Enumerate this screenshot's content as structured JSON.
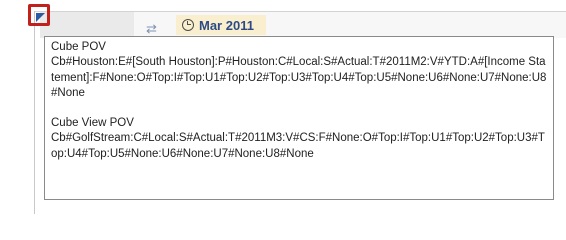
{
  "header": {
    "period_label": "Mar 2011",
    "sync_icon": "sync-icon",
    "clock_icon": "clock-icon",
    "marker_color": "#2b5aa5",
    "highlight_color": "#c0211b"
  },
  "tooltip": {
    "cube_pov_title": "Cube POV",
    "cube_pov_value": "Cb#Houston:E#[South Houston]:P#Houston:C#Local:S#Actual:T#2011M2:V#YTD:A#[Income Statement]:F#None:O#Top:I#Top:U1#Top:U2#Top:U3#Top:U4#Top:U5#None:U6#None:U7#None:U8#None",
    "cube_view_pov_title": "Cube View POV",
    "cube_view_pov_value": "Cb#GolfStream:C#Local:S#Actual:T#2011M3:V#CS:F#None:O#Top:I#Top:U1#Top:U2#Top:U3#Top:U4#Top:U5#None:U6#None:U7#None:U8#None"
  }
}
